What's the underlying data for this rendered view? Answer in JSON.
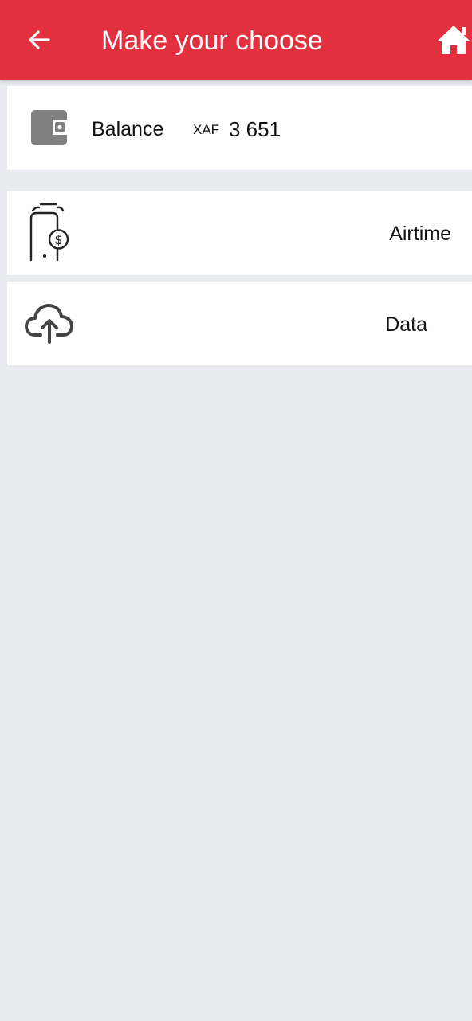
{
  "header": {
    "title": "Make your choose",
    "back_icon": "arrow-left-icon",
    "home_icon": "home-icon",
    "color": "#e3303f"
  },
  "balance": {
    "icon": "wallet-icon",
    "label": "Balance",
    "currency": "XAF",
    "amount": "3 651"
  },
  "services": [
    {
      "icon": "phone-coin-icon",
      "label": "Airtime"
    },
    {
      "icon": "cloud-upload-icon",
      "label": "Data"
    }
  ],
  "colors": {
    "background": "#e9e9f2",
    "card": "#ffffff",
    "icon": "#444444"
  }
}
